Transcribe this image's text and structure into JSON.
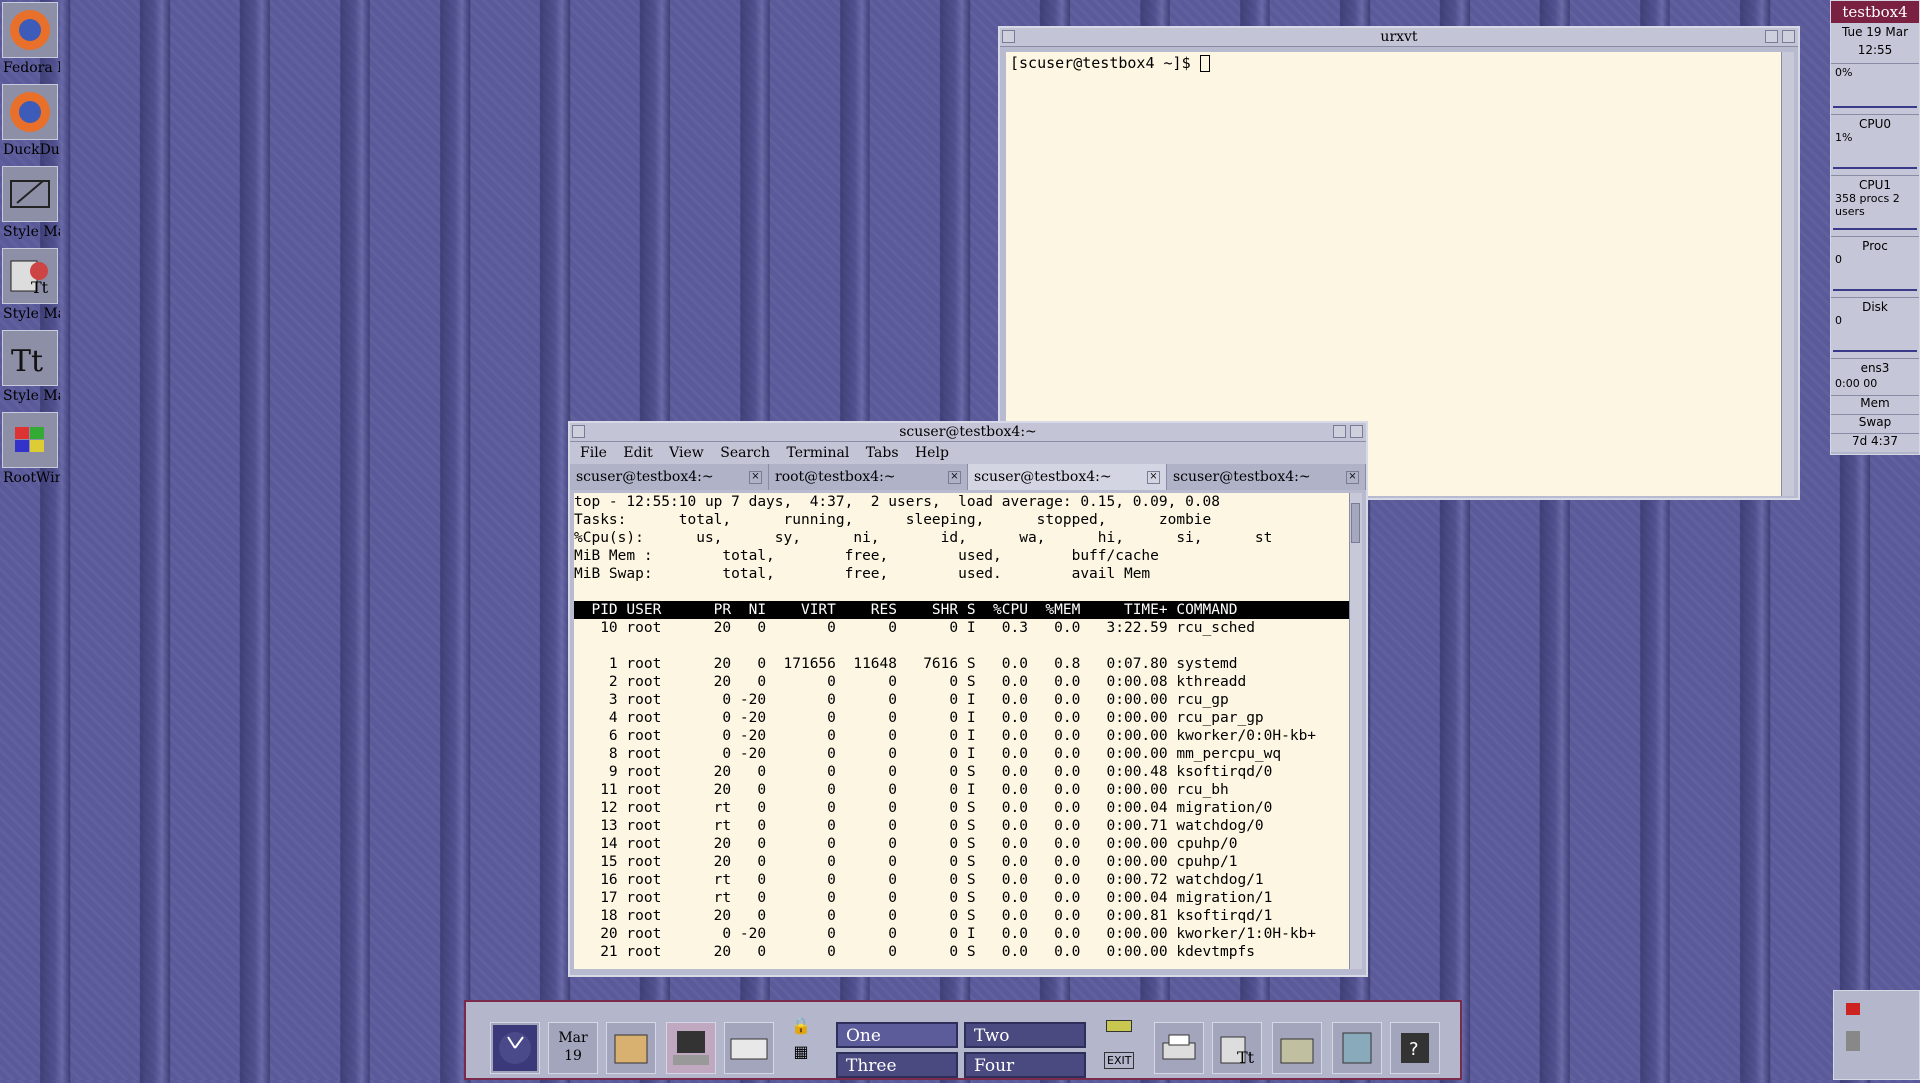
{
  "desktop_icons": [
    {
      "label": "Fedora B",
      "icon": "firefox-icon"
    },
    {
      "label": "DuckDuc",
      "icon": "firefox-icon"
    },
    {
      "label": "Style Ma",
      "icon": "style-manager-icon"
    },
    {
      "label": "Style Ma",
      "icon": "palette-icon"
    },
    {
      "label": "Style Ma",
      "icon": "font-icon"
    },
    {
      "label": "RootWin",
      "icon": "root-window-icon"
    }
  ],
  "urxvt": {
    "title": "urxvt",
    "prompt": "[scuser@testbox4 ~]$ "
  },
  "gterm": {
    "title": "scuser@testbox4:~",
    "menu": [
      "File",
      "Edit",
      "View",
      "Search",
      "Terminal",
      "Tabs",
      "Help"
    ],
    "tabs": [
      "scuser@testbox4:~",
      "root@testbox4:~",
      "scuser@testbox4:~",
      "scuser@testbox4:~"
    ],
    "active_tab": 2,
    "summary": [
      "top - 12:55:10 up 7 days,  4:37,  2 users,  load average: 0.15, 0.09, 0.08",
      "Tasks:      total,      running,      sleeping,      stopped,      zombie",
      "%Cpu(s):      us,      sy,      ni,       id,      wa,      hi,      si,      st",
      "MiB Mem :        total,        free,        used,        buff/cache",
      "MiB Swap:        total,        free,        used.        avail Mem"
    ],
    "header": "  PID USER      PR  NI    VIRT    RES    SHR S  %CPU  %MEM     TIME+ COMMAND",
    "rows": [
      "   10 root      20   0       0      0      0 I   0.3   0.0   3:22.59 rcu_sched",
      "",
      "    1 root      20   0  171656  11648   7616 S   0.0   0.8   0:07.80 systemd",
      "    2 root      20   0       0      0      0 S   0.0   0.0   0:00.08 kthreadd",
      "    3 root       0 -20       0      0      0 I   0.0   0.0   0:00.00 rcu_gp",
      "    4 root       0 -20       0      0      0 I   0.0   0.0   0:00.00 rcu_par_gp",
      "    6 root       0 -20       0      0      0 I   0.0   0.0   0:00.00 kworker/0:0H-kb+",
      "    8 root       0 -20       0      0      0 I   0.0   0.0   0:00.00 mm_percpu_wq",
      "    9 root      20   0       0      0      0 S   0.0   0.0   0:00.48 ksoftirqd/0",
      "   11 root      20   0       0      0      0 I   0.0   0.0   0:00.00 rcu_bh",
      "   12 root      rt   0       0      0      0 S   0.0   0.0   0:00.04 migration/0",
      "   13 root      rt   0       0      0      0 S   0.0   0.0   0:00.71 watchdog/0",
      "   14 root      20   0       0      0      0 S   0.0   0.0   0:00.00 cpuhp/0",
      "   15 root      20   0       0      0      0 S   0.0   0.0   0:00.00 cpuhp/1",
      "   16 root      rt   0       0      0      0 S   0.0   0.0   0:00.72 watchdog/1",
      "   17 root      rt   0       0      0      0 S   0.0   0.0   0:00.04 migration/1",
      "   18 root      20   0       0      0      0 S   0.0   0.0   0:00.81 ksoftirqd/1",
      "   20 root       0 -20       0      0      0 I   0.0   0.0   0:00.00 kworker/1:0H-kb+",
      "   21 root      20   0       0      0      0 S   0.0   0.0   0:00.00 kdevtmpfs"
    ]
  },
  "monitor": {
    "host": "testbox4",
    "date": "Tue 19 Mar",
    "time": "12:55",
    "sections": [
      {
        "title": "",
        "value": "0%"
      },
      {
        "title": "CPU0",
        "value": "1%"
      },
      {
        "title": "CPU1",
        "value": "358 procs  2 users"
      },
      {
        "title": "Proc",
        "value": "0"
      },
      {
        "title": "Disk",
        "value": "0"
      },
      {
        "title": "ens3",
        "value": "0:00 00"
      }
    ],
    "mem": "Mem",
    "swap": "Swap",
    "uptime": "7d 4:37"
  },
  "panel": {
    "date_month": "Mar",
    "date_day": "19",
    "workspaces": [
      "One",
      "Two",
      "Three",
      "Four"
    ],
    "current_workspace": "One",
    "exit_label": "EXIT"
  }
}
